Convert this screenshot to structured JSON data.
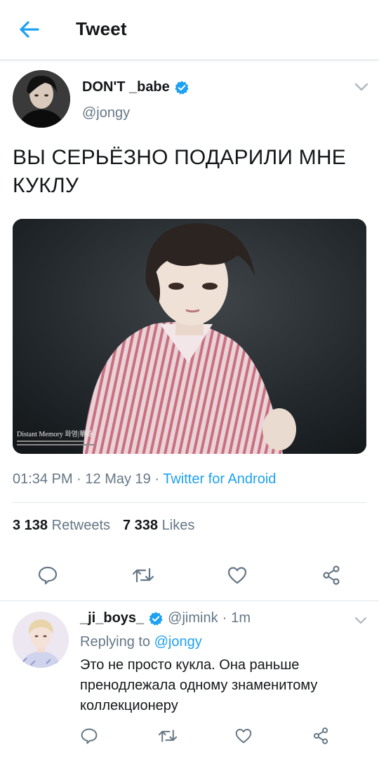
{
  "header": {
    "title": "Tweet",
    "back_icon": "arrow-left-icon",
    "accent": "#1da1f2"
  },
  "tweet": {
    "author_name": "DON'T _babe",
    "author_handle": "@jongy",
    "verified": true,
    "text": "ВЫ СЕРЬЁЗНО ПОДАРИЛИ МНЕ КУКЛУ",
    "image_caption": "Distant Memory 화영|華詠",
    "time": "01:34 PM",
    "date": "12 May 19",
    "source": "Twitter for Android",
    "retweets_count": "3 138",
    "retweets_label": "Retweets",
    "likes_count": "7 338",
    "likes_label": "Likes"
  },
  "reply": {
    "author_name": "_ji_boys_",
    "author_handle": "@jimink",
    "time_ago": "1m",
    "replying_to_label": "Replying to",
    "replying_to_handle": "@jongy",
    "text": "Это не просто кукла. Она раньше пренодлежала одному знаменитому коллекционеру"
  },
  "colors": {
    "text_primary": "#14171a",
    "text_secondary": "#657786",
    "link": "#1da1f2",
    "divider": "#e1e8ed"
  }
}
